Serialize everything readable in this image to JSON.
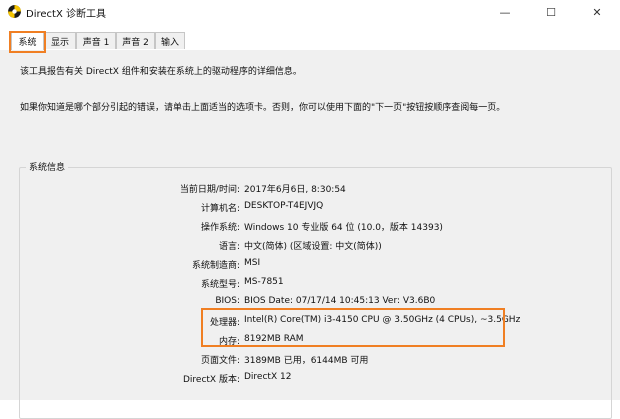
{
  "window": {
    "title": "DirectX 诊断工具",
    "minimize_glyph": "—",
    "maximize_glyph": "☐",
    "close_glyph": "✕"
  },
  "tabs": [
    {
      "label": "系统",
      "active": true
    },
    {
      "label": "显示",
      "active": false
    },
    {
      "label": "声音 1",
      "active": false
    },
    {
      "label": "声音 2",
      "active": false
    },
    {
      "label": "输入",
      "active": false
    }
  ],
  "intro": {
    "line1": "该工具报告有关 DirectX 组件和安装在系统上的驱动程序的详细信息。",
    "line2": "如果你知道是哪个部分引起的错误，请单击上面适当的选项卡。否则，你可以使用下面的\"下一页\"按钮按顺序查阅每一页。"
  },
  "sysinfo": {
    "title": "系统信息",
    "rows": [
      {
        "label": "当前日期/时间:",
        "value": "2017年6月6日, 8:30:54"
      },
      {
        "label": "计算机名:",
        "value": "DESKTOP-T4EJVJQ"
      },
      {
        "label": "操作系统:",
        "value": "Windows 10 专业版 64 位 (10.0，版本 14393)"
      },
      {
        "label": "语言:",
        "value": "中文(简体) (区域设置: 中文(简体))"
      },
      {
        "label": "系统制造商:",
        "value": "MSI"
      },
      {
        "label": "系统型号:",
        "value": "MS-7851"
      },
      {
        "label": "BIOS:",
        "value": "BIOS Date: 07/17/14 10:45:13 Ver: V3.6B0"
      },
      {
        "label": "处理器:",
        "value": "Intel(R) Core(TM) i3-4150 CPU @ 3.50GHz (4 CPUs), ~3.5GHz"
      },
      {
        "label": "内存:",
        "value": "8192MB RAM"
      },
      {
        "label": "页面文件:",
        "value": "3189MB 已用，6144MB 可用"
      },
      {
        "label": "DirectX 版本:",
        "value": "DirectX 12"
      }
    ]
  },
  "colors": {
    "highlight": "#f07f23",
    "panel_bg": "#f0f0f0"
  },
  "icons": {
    "app": "directx-icon"
  }
}
